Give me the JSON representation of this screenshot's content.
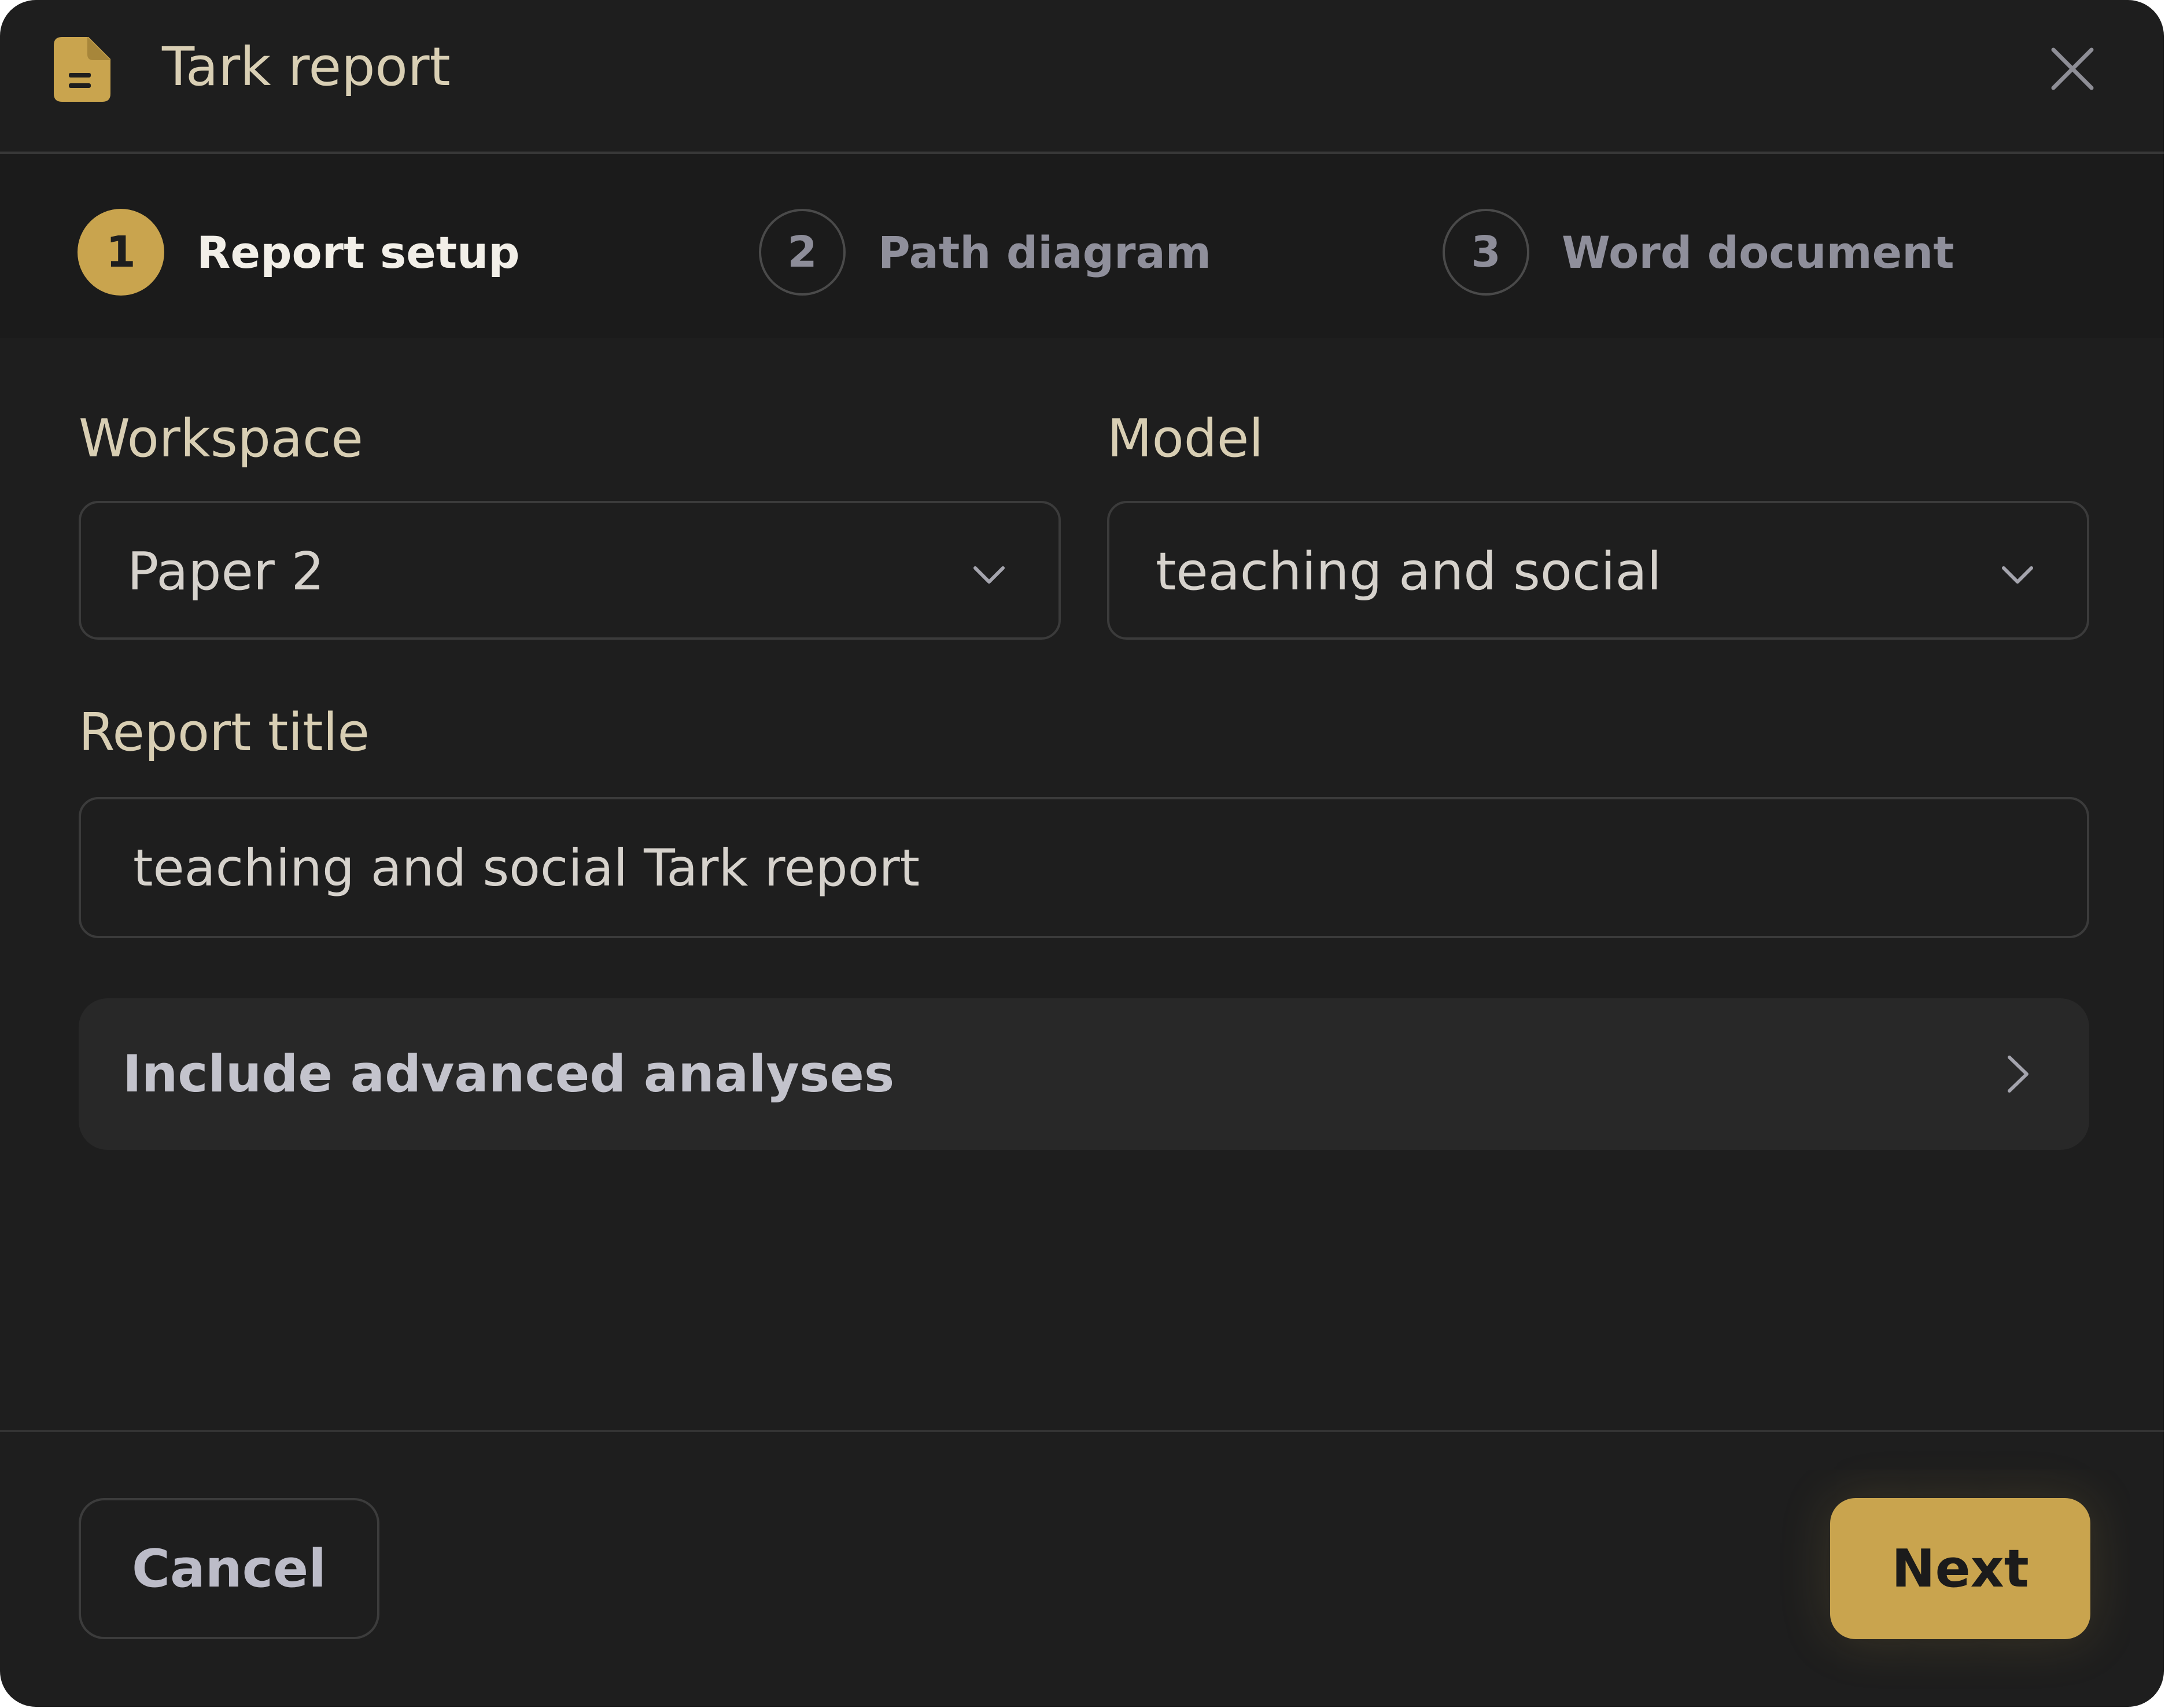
{
  "dialog": {
    "title": "Tark report",
    "icon": "document-icon",
    "close_icon": "close-icon"
  },
  "steps": [
    {
      "number": "1",
      "label": "Report setup",
      "state": "active"
    },
    {
      "number": "2",
      "label": "Path diagram",
      "state": "inactive"
    },
    {
      "number": "3",
      "label": "Word document",
      "state": "inactive"
    }
  ],
  "form": {
    "workspace": {
      "label": "Workspace",
      "value": "Paper 2"
    },
    "model": {
      "label": "Model",
      "value": "teaching and social"
    },
    "report_title": {
      "label": "Report title",
      "value": "teaching and social Tark report"
    },
    "advanced": {
      "label": "Include advanced analyses"
    }
  },
  "footer": {
    "cancel_label": "Cancel",
    "next_label": "Next"
  },
  "colors": {
    "background": "#1e1e1e",
    "accent": "#c9a44e",
    "label_text": "#d8ceb3",
    "muted_text": "#8f8f9b"
  }
}
